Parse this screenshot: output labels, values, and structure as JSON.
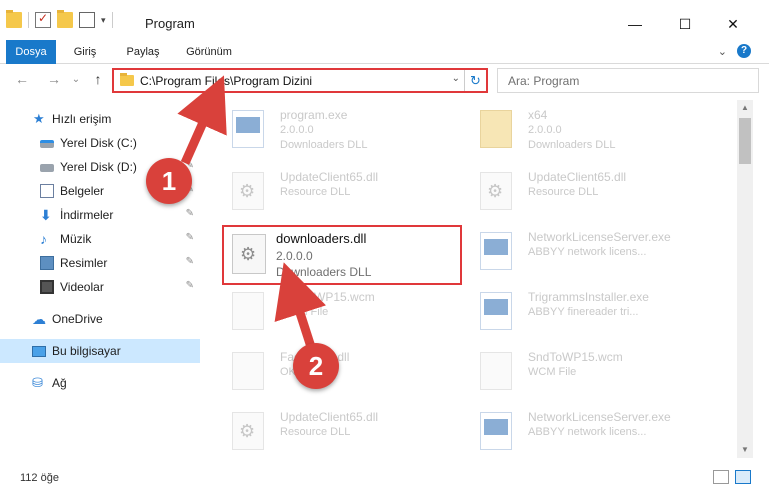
{
  "window": {
    "title": "Program",
    "minimize_glyph": "—",
    "maximize_glyph": "☐",
    "close_glyph": "✕"
  },
  "ribbon": {
    "tabs": [
      "Dosya",
      "Giriş",
      "Paylaş",
      "Görünüm"
    ],
    "help_glyph": "?",
    "expand_glyph": "⌄",
    "accent_color": "#1979ca"
  },
  "navigation": {
    "back_glyph": "←",
    "forward_glyph": "→",
    "recent_glyph": "⌄",
    "up_glyph": "↑",
    "address_path": "C:\\Program Files\\Program Dizini",
    "address_dropdown_glyph": "⌄",
    "refresh_glyph": "↻",
    "search_placeholder": "Ara: Program"
  },
  "sidebar": {
    "items": [
      {
        "label": "Hızlı erişim",
        "icon": "star-icon",
        "pinned": false
      },
      {
        "label": "Yerel Disk (C:)",
        "icon": "drive-c-icon",
        "pinned": true
      },
      {
        "label": "Yerel Disk (D:)",
        "icon": "drive-d-icon",
        "pinned": true
      },
      {
        "label": "Belgeler",
        "icon": "documents-icon",
        "pinned": true
      },
      {
        "label": "İndirmeler",
        "icon": "downloads-icon",
        "pinned": true
      },
      {
        "label": "Müzik",
        "icon": "music-icon",
        "pinned": true
      },
      {
        "label": "Resimler",
        "icon": "pictures-icon",
        "pinned": true
      },
      {
        "label": "Videolar",
        "icon": "videos-icon",
        "pinned": true
      },
      {
        "label": "OneDrive",
        "icon": "onedrive-icon",
        "pinned": false
      },
      {
        "label": "Bu bilgisayar",
        "icon": "this-pc-icon",
        "pinned": false,
        "selected": true
      },
      {
        "label": "Ağ",
        "icon": "network-icon",
        "pinned": false
      }
    ],
    "pin_glyph": "📌"
  },
  "files": {
    "left_column": [
      {
        "name": "program.exe",
        "meta1": "2.0.0.0",
        "meta2": "Downloaders DLL",
        "icon": "exe-icon"
      },
      {
        "name": "UpdateClient65.dll",
        "meta1": "Resource DLL",
        "meta2": "",
        "icon": "dll-gear-icon"
      },
      {
        "name": "SndToWP15.wcm",
        "meta1": "WCM File",
        "meta2": "",
        "icon": "file-icon"
      },
      {
        "name": "FaceBook.dll",
        "meta1": "OK",
        "meta2": "",
        "icon": "file-icon"
      },
      {
        "name": "UpdateClient65.dll",
        "meta1": "Resource DLL",
        "meta2": "",
        "icon": "dll-gear-icon"
      }
    ],
    "right_column": [
      {
        "name": "x64",
        "meta1": "2.0.0.0",
        "meta2": "Downloaders DLL",
        "icon": "folder-icon"
      },
      {
        "name": "UpdateClient65.dll",
        "meta1": "Resource DLL",
        "meta2": "",
        "icon": "dll-gear-icon"
      },
      {
        "name": "NetworkLicenseServer.exe",
        "meta1": "ABBYY network licens...",
        "meta2": "",
        "icon": "exe-icon"
      },
      {
        "name": "TrigrammsInstaller.exe",
        "meta1": "ABBYY finereader tri...",
        "meta2": "",
        "icon": "exe-icon"
      },
      {
        "name": "SndToWP15.wcm",
        "meta1": "WCM File",
        "meta2": "",
        "icon": "file-icon"
      },
      {
        "name": "NetworkLicenseServer.exe",
        "meta1": "ABBYY network licens...",
        "meta2": "",
        "icon": "exe-icon"
      }
    ],
    "highlighted": {
      "name": "downloaders.dll",
      "meta1": "2.0.0.0",
      "meta2": "Downloaders DLL"
    }
  },
  "status": {
    "item_count": "112 öğe"
  },
  "annotations": {
    "step1": "1",
    "step2": "2",
    "color": "#d9413b"
  }
}
